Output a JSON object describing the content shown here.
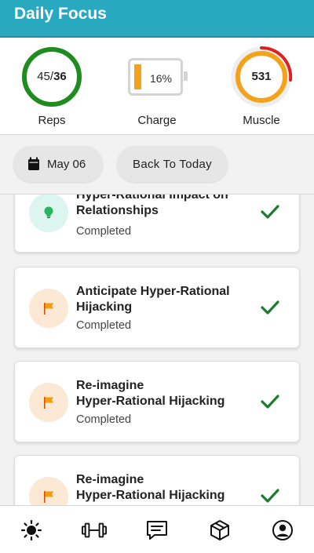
{
  "header": {
    "title": "Daily Focus"
  },
  "stats": {
    "reps": {
      "current": "45/",
      "target": "36",
      "label": "Reps",
      "progress": 1.0,
      "color": "#1e8c1e"
    },
    "charge": {
      "value": "16%",
      "label": "Charge",
      "progress": 0.16,
      "color": "#f4a21b"
    },
    "muscle": {
      "value": "531",
      "label": "Muscle",
      "ring_color": "#f4a21b",
      "accent_color": "#e02020"
    }
  },
  "datebar": {
    "date_label": "May 06",
    "back_label": "Back To Today",
    "calendar_icon": "calendar-icon"
  },
  "tasks": [
    {
      "title": "Hyper-Rational Impact on Relationships",
      "status": "Completed",
      "icon": "lightbulb-icon",
      "done": true
    },
    {
      "title": "Anticipate Hyper-Rational Hijacking",
      "status": "Completed",
      "icon": "flag-icon",
      "done": true
    },
    {
      "title": "Re-imagine\nHyper-Rational Hijacking",
      "status": "Completed",
      "icon": "flag-icon",
      "done": true
    },
    {
      "title": "Re-imagine\nHyper-Rational Hijacking",
      "status": "",
      "icon": "flag-icon",
      "done": true
    }
  ],
  "tabbar": {
    "items": [
      "sun-icon",
      "dumbbell-icon",
      "chat-icon",
      "box-icon",
      "profile-icon"
    ]
  },
  "colors": {
    "header": "#29a9c0",
    "check": "#1e7a2e",
    "bulb": "#28b463",
    "flag": "#f39c12"
  }
}
